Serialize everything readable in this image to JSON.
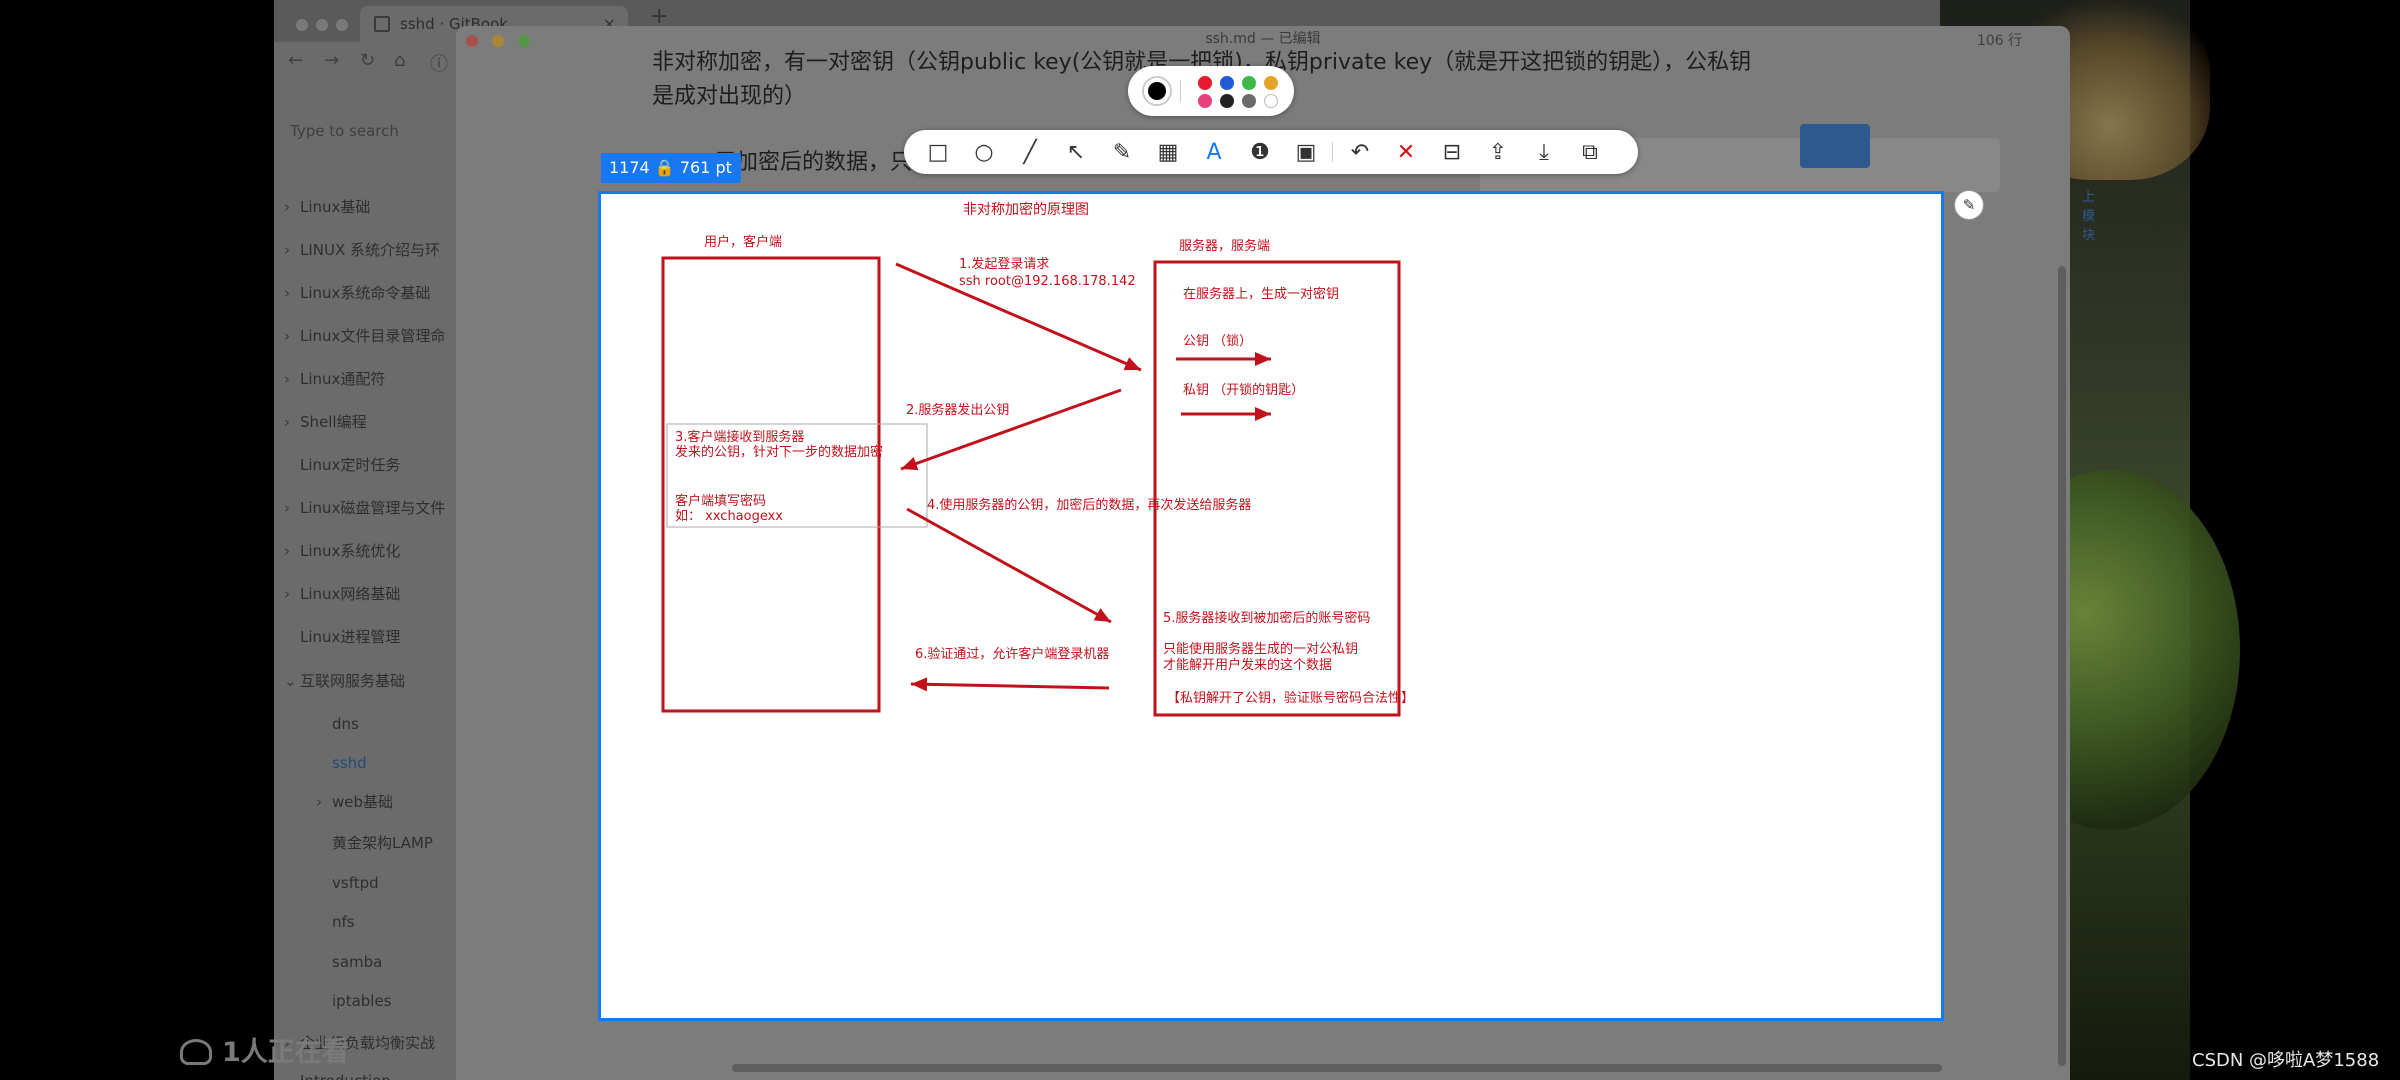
{
  "browser": {
    "tab_title": "sshd · GitBook",
    "new_tab": "+",
    "nav_icons": [
      "←",
      "→",
      "↻",
      "⌂",
      "ⓘ"
    ],
    "search_placeholder": "Type to search",
    "sidebar_items": [
      {
        "label": "Linux基础",
        "chevron": "›"
      },
      {
        "label": "LINUX 系统介绍与环",
        "chevron": "›"
      },
      {
        "label": "Linux系统命令基础",
        "chevron": "›"
      },
      {
        "label": "Linux文件目录管理命",
        "chevron": "›"
      },
      {
        "label": "Linux通配符",
        "chevron": "›"
      },
      {
        "label": "Shell编程",
        "chevron": "›"
      },
      {
        "label": "Linux定时任务",
        "chevron": ""
      },
      {
        "label": "Linux磁盘管理与文件",
        "chevron": "›"
      },
      {
        "label": "Linux系统优化",
        "chevron": "›"
      },
      {
        "label": "Linux网络基础",
        "chevron": "›"
      },
      {
        "label": "Linux进程管理",
        "chevron": ""
      },
      {
        "label": "互联网服务基础",
        "chevron": "⌄"
      },
      {
        "label": "dns",
        "chevron": ""
      },
      {
        "label": "sshd",
        "chevron": "",
        "active": true
      },
      {
        "label": "web基础",
        "chevron": "›"
      },
      {
        "label": "黄金架构LAMP",
        "chevron": ""
      },
      {
        "label": "vsftpd",
        "chevron": ""
      },
      {
        "label": "nfs",
        "chevron": ""
      },
      {
        "label": "samba",
        "chevron": ""
      },
      {
        "label": "iptables",
        "chevron": ""
      },
      {
        "label": "企业级负载均衡实战",
        "chevron": "›"
      },
      {
        "label": "Introduction",
        "chevron": ""
      }
    ],
    "side_note": "上模块"
  },
  "editor": {
    "title": "ssh.md — 已编辑",
    "line_count": "106 行",
    "para1_line1": "非对称加密，有一对密钥（公钥public key(公钥就是一把锁)，私钥private key（就是开这把锁的钥匙），公私钥",
    "para1_line2": "是成对出现的）",
    "para2_fragment": "用加密后的数据，只"
  },
  "capture": {
    "size_label": "1174 🔒 761  pt",
    "pin_icon": "✎"
  },
  "toolbar": {
    "tools": [
      {
        "name": "rectangle-tool",
        "glyph": "□"
      },
      {
        "name": "ellipse-tool",
        "glyph": "○"
      },
      {
        "name": "line-tool",
        "glyph": "╱"
      },
      {
        "name": "arrow-tool",
        "glyph": "↖"
      },
      {
        "name": "pen-tool",
        "glyph": "✎"
      },
      {
        "name": "mosaic-tool",
        "glyph": "▦"
      },
      {
        "name": "text-tool",
        "glyph": "A"
      },
      {
        "name": "number-tool",
        "glyph": "❶"
      },
      {
        "name": "blur-tool",
        "glyph": "▣"
      },
      {
        "name": "undo-button",
        "glyph": "↶"
      },
      {
        "name": "cancel-button",
        "glyph": "✕"
      },
      {
        "name": "pin-button",
        "glyph": "⊟"
      },
      {
        "name": "upload-button",
        "glyph": "⇪"
      },
      {
        "name": "download-button",
        "glyph": "⤓"
      },
      {
        "name": "copy-button",
        "glyph": "⧉"
      }
    ],
    "colors": {
      "current": "#000000",
      "swatches": [
        "#e8192c",
        "#2159d6",
        "#3fb84a",
        "#e3a42a",
        "#e8407a",
        "#222222",
        "#6b6b6b",
        "#ffffff"
      ]
    }
  },
  "diagram": {
    "title": "非对称加密的原理图",
    "client_title": "用户，客户端",
    "server_title": "服务器，服务端",
    "step1_line1": "1.发起登录请求",
    "step1_line2": "ssh  root@192.168.178.142",
    "server_gen": "在服务器上，生成一对密钥",
    "public_key": "公钥  （锁）",
    "private_key": "私钥    （开锁的钥匙）",
    "step2": "2.服务器发出公钥",
    "step3_line1": "3.客户端接收到服务器",
    "step3_line2": "发来的公钥，针对下一步的数据加密",
    "client_pwd_line1": "客户端填写密码",
    "client_pwd_line2": "如：  xxchaogexx",
    "step4": "4.使用服务器的公钥，加密后的数据，再次发送给服务器",
    "step5_line1": "5.服务器接收到被加密后的账号密码",
    "step5_line2": "只能使用服务器生成的一对公私钥",
    "step5_line3": "才能解开用户发来的这个数据",
    "step5_line4": "【私钥解开了公钥，验证账号密码合法性】",
    "step6": "6.验证通过，允许客户端登录机器",
    "stroke_color": "#c1121c"
  },
  "overlay": {
    "watchers": "1人正在看",
    "credit": "CSDN @哆啦A梦1588"
  }
}
